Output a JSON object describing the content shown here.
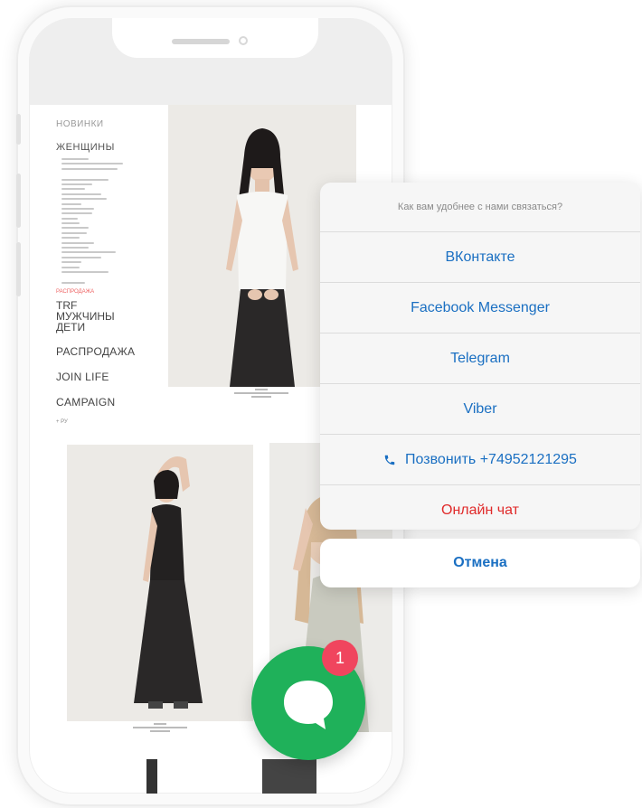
{
  "site_menu": {
    "new_label": "НОВИНКИ",
    "women_label": "ЖЕНЩИНЫ",
    "sale_sub_label": "РАСПРОДАЖА",
    "trf_label": "TRF",
    "men_label": "МУЖЧИНЫ",
    "kids_label": "ДЕТИ",
    "sale_label": "РАСПРОДАЖА",
    "join_life_label": "JOIN LIFE",
    "campaign_label": "CAMPAIGN",
    "language_label": "+ РУ"
  },
  "contact_sheet": {
    "title": "Как вам удобнее с нами связаться?",
    "options": [
      {
        "label": "ВКонтакте"
      },
      {
        "label": "Facebook Messenger"
      },
      {
        "label": "Telegram"
      },
      {
        "label": "Viber"
      },
      {
        "label": "Позвонить +74952121295",
        "icon": "phone-icon"
      },
      {
        "label": "Онлайн чат"
      }
    ],
    "cancel_label": "Отмена"
  },
  "chat_fab": {
    "badge_count": "1",
    "icon": "chat-bubble-icon",
    "color": "#1fb15a",
    "badge_color": "#f0455e"
  },
  "colors": {
    "link_blue": "#1a6fc2",
    "destructive_red": "#e02a2a"
  }
}
